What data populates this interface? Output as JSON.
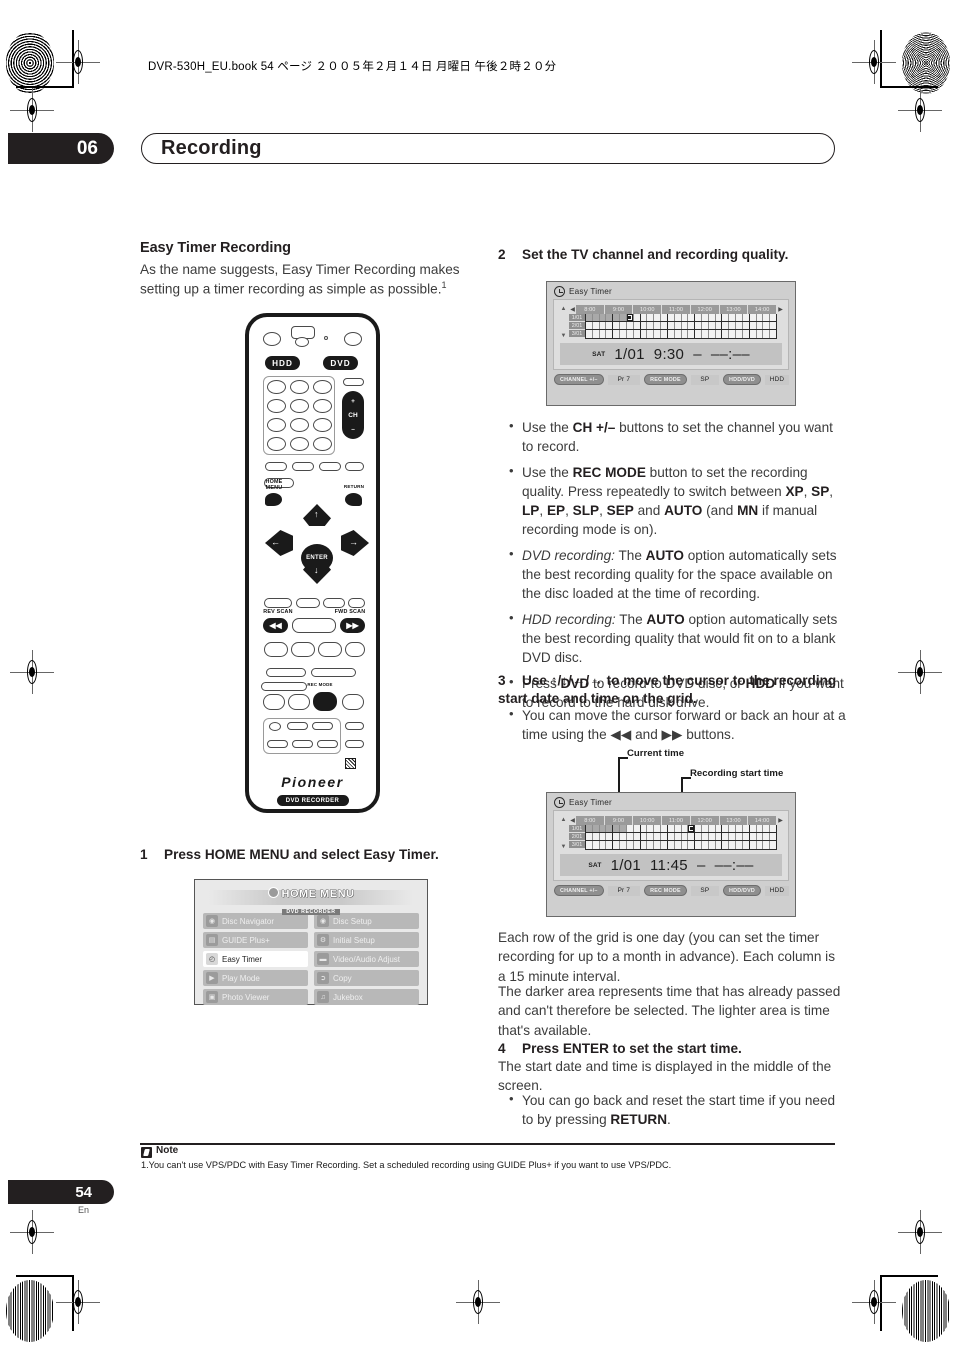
{
  "print_header": {
    "book_line": "DVR-530H_EU.book   54 ページ   ２００５年２月１４日   月曜日   午後２時２０分"
  },
  "chapter": {
    "number": "06",
    "title": "Recording"
  },
  "left_column": {
    "section_title": "Easy Timer Recording",
    "intro": "As the name suggests, Easy Timer Recording makes setting up a timer recording as simple as possible.",
    "intro_footnote_marker": "1",
    "step1": {
      "num": "1",
      "text": "Press HOME MENU and select Easy Timer."
    }
  },
  "remote": {
    "hdd_label": "HDD",
    "dvd_label": "DVD",
    "ch_plus": "+",
    "ch_label": "CH",
    "ch_minus": "–",
    "home_menu_label": "HOME MENU",
    "return_label": "RETURN",
    "enter_label": "ENTER",
    "rev_scan_label": "REV SCAN",
    "fwd_scan_label": "FWD SCAN",
    "rec_mode_label": "REC MODE",
    "brand": "Pioneer",
    "product_pill": "DVD RECORDER",
    "arrow_up": "↑",
    "arrow_down": "↓",
    "arrow_left": "←",
    "arrow_right": "→",
    "rev_glyph": "◀◀",
    "fwd_glyph": "▶▶"
  },
  "home_menu": {
    "title": "HOME MENU",
    "subtitle": "DVD RECORDER",
    "items_left": [
      {
        "label": "Disc Navigator",
        "icon": "disc-navigator-icon",
        "selected": false
      },
      {
        "label": "GUIDE Plus+",
        "icon": "guide-plus-icon",
        "selected": false
      },
      {
        "label": "Easy Timer",
        "icon": "easy-timer-icon",
        "selected": true
      },
      {
        "label": "Play Mode",
        "icon": "play-mode-icon",
        "selected": false
      },
      {
        "label": "Photo Viewer",
        "icon": "photo-viewer-icon",
        "selected": false
      }
    ],
    "items_right": [
      {
        "label": "Disc Setup",
        "icon": "disc-setup-icon",
        "selected": false
      },
      {
        "label": "Initial Setup",
        "icon": "initial-setup-icon",
        "selected": false
      },
      {
        "label": "Video/Audio Adjust",
        "icon": "video-audio-adjust-icon",
        "selected": false
      },
      {
        "label": "Copy",
        "icon": "copy-icon",
        "selected": false
      },
      {
        "label": "Jukebox",
        "icon": "jukebox-icon",
        "selected": false
      }
    ]
  },
  "right_column": {
    "step2": {
      "num": "2",
      "text": "Set the TV channel and recording quality."
    },
    "step2_bullets": [
      "Use the CH +/– buttons to set the channel you want to record.",
      "Use the REC MODE button to set the recording quality. Press repeatedly to switch between XP, SP, LP, EP, SLP, SEP and AUTO (and MN if manual recording mode is on).",
      "DVD recording: The AUTO option automatically sets the best recording quality for the space available on the disc loaded at the time of recording.",
      "HDD recording: The AUTO option automatically sets the best recording quality that would fit on to a blank DVD disc.",
      "Press DVD to record to DVD disc, or HDD if you want to record to the hard disk drive."
    ],
    "step3": {
      "num": "3",
      "text": "Use ↑/↓/←/→ to move the cursor to the recording start date and time on the grid."
    },
    "step3_bullet": "You can move the cursor forward or back an hour at a time using the ◀◀ and ▶▶ buttons.",
    "callout_current_time": "Current time",
    "callout_recording_start_time": "Recording start time",
    "para_rows": "Each row of the grid is one day (you can set the timer recording for up to a month in advance). Each column is a 15 minute interval.",
    "para_shading": "The darker area represents time that has already passed and can't therefore be selected. The lighter area is time that's available.",
    "step4": {
      "num": "4",
      "text": "Press ENTER to set the start time."
    },
    "step4_body": "The start date and time is displayed in the middle of the screen.",
    "step4_bullet": "You can go back and reset the start time if you need to by pressing RETURN."
  },
  "osd_screens": [
    {
      "id": "easy-timer-screen-1",
      "title": "Easy Timer",
      "hours": [
        "8:00",
        "9:00",
        "10:00",
        "11:00",
        "12:00",
        "13:00",
        "14:00"
      ],
      "days": [
        "1/01",
        "2/01",
        "3/01"
      ],
      "past_quarters_row1": 6,
      "cursor_hour_index": 1,
      "cursor_quarter_index": 2,
      "readout": {
        "weekday": "SAT",
        "date": "1/01",
        "start_time": "9:30",
        "dash": "–",
        "end_time": "––:––"
      },
      "footer": [
        {
          "button": "CHANNEL +/–",
          "value": "Pr 7"
        },
        {
          "button": "REC MODE",
          "value": "SP"
        },
        {
          "button": "HDD/DVD",
          "value": "HDD"
        }
      ],
      "scroll_up": "▲",
      "scroll_down": "▼",
      "page_left": "◀",
      "page_right": "▶"
    },
    {
      "id": "easy-timer-screen-2",
      "title": "Easy Timer",
      "hours": [
        "8:00",
        "9:00",
        "10:00",
        "11:00",
        "12:00",
        "13:00",
        "14:00"
      ],
      "days": [
        "1/01",
        "2/01",
        "3/01"
      ],
      "past_quarters_row1": 6,
      "cursor_hour_index": 3,
      "cursor_quarter_index": 3,
      "readout": {
        "weekday": "SAT",
        "date": "1/01",
        "start_time": "11:45",
        "dash": "–",
        "end_time": "––:––"
      },
      "footer": [
        {
          "button": "CHANNEL +/–",
          "value": "Pr 7"
        },
        {
          "button": "REC MODE",
          "value": "SP"
        },
        {
          "button": "HDD/DVD",
          "value": "HDD"
        }
      ],
      "scroll_up": "▲",
      "scroll_down": "▼",
      "page_left": "◀",
      "page_right": "▶"
    }
  ],
  "note": {
    "label": "Note",
    "text": "1.You can't use VPS/PDC with Easy Timer Recording. Set a scheduled recording using GUIDE Plus+ if you want to use VPS/PDC."
  },
  "footer": {
    "page_number": "54",
    "language": "En"
  }
}
